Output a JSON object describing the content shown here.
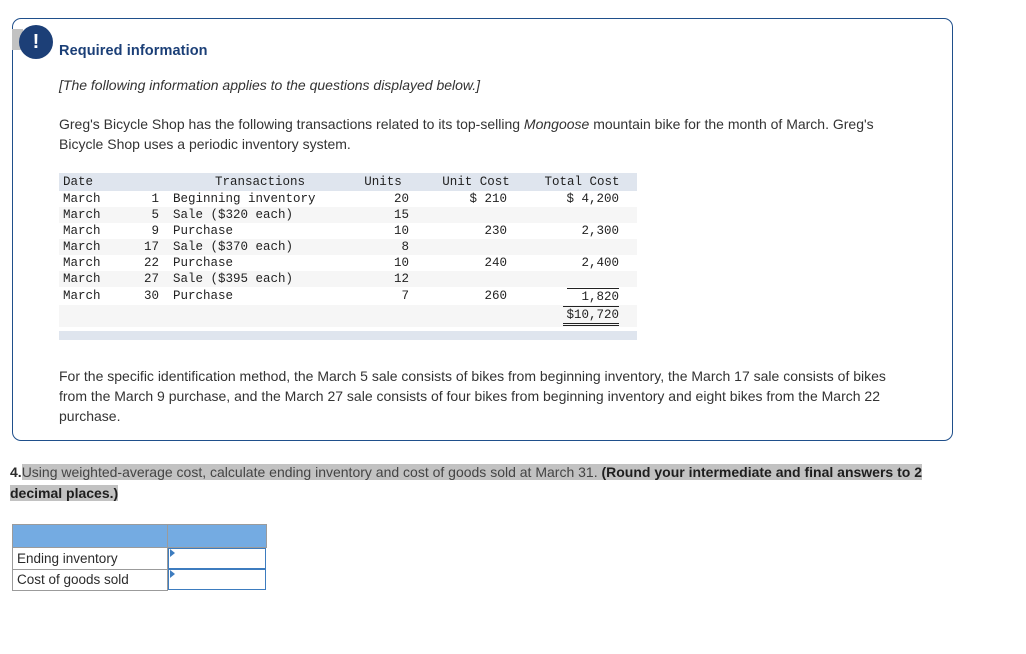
{
  "panel": {
    "alert_icon": "exclamation-icon",
    "alert_glyph": "!",
    "heading": "Required information",
    "italic_note": "[The following information applies to the questions displayed below.]",
    "body_part1": "Greg's Bicycle Shop has the following transactions related to its top-selling ",
    "body_italic": "Mongoose",
    "body_part2": " mountain bike for the month of March. Greg's Bicycle Shop uses a periodic inventory system.",
    "spec_id_paragraph": "For the specific identification method, the March 5 sale consists of bikes from beginning inventory, the March 17 sale consists of bikes from the March 9 purchase, and the March 27 sale consists of four bikes from beginning inventory and eight bikes from the March 22 purchase."
  },
  "transactions_table": {
    "headers": [
      "Date",
      "Transactions",
      "Units",
      "Unit Cost",
      "Total Cost"
    ],
    "rows": [
      {
        "month": "March",
        "day": "1",
        "transaction": "Beginning inventory",
        "units": "20",
        "unit_cost": "$ 210",
        "total_cost": "$ 4,200"
      },
      {
        "month": "March",
        "day": "5",
        "transaction": "Sale ($320 each)",
        "units": "15",
        "unit_cost": "",
        "total_cost": ""
      },
      {
        "month": "March",
        "day": "9",
        "transaction": "Purchase",
        "units": "10",
        "unit_cost": "230",
        "total_cost": "2,300"
      },
      {
        "month": "March",
        "day": "17",
        "transaction": "Sale ($370 each)",
        "units": "8",
        "unit_cost": "",
        "total_cost": ""
      },
      {
        "month": "March",
        "day": "22",
        "transaction": "Purchase",
        "units": "10",
        "unit_cost": "240",
        "total_cost": "2,400"
      },
      {
        "month": "March",
        "day": "27",
        "transaction": "Sale ($395 each)",
        "units": "12",
        "unit_cost": "",
        "total_cost": ""
      },
      {
        "month": "March",
        "day": "30",
        "transaction": "Purchase",
        "units": "7",
        "unit_cost": "260",
        "total_cost": "1,820"
      }
    ],
    "grand_total": "$10,720"
  },
  "question": {
    "number": "4.",
    "text_plain": "Using weighted-average cost, calculate ending inventory and cost of goods sold at March 31. ",
    "text_bold": "(Round your intermediate and final answers to 2 decimal places.)"
  },
  "answer_table": {
    "header_col1": "",
    "header_col2": "",
    "rows": [
      {
        "label": "Ending inventory",
        "value": ""
      },
      {
        "label": "Cost of goods sold",
        "value": ""
      }
    ]
  },
  "colors": {
    "panel_border": "#1f4f8b",
    "badge_bg": "#1c3f77",
    "heading": "#1b3f77",
    "table_header_bg": "#dfe5ee",
    "answer_header_blue": "#74abe2",
    "input_border_blue": "#3d7cbf",
    "highlight_grey": "#c2c2c2"
  }
}
